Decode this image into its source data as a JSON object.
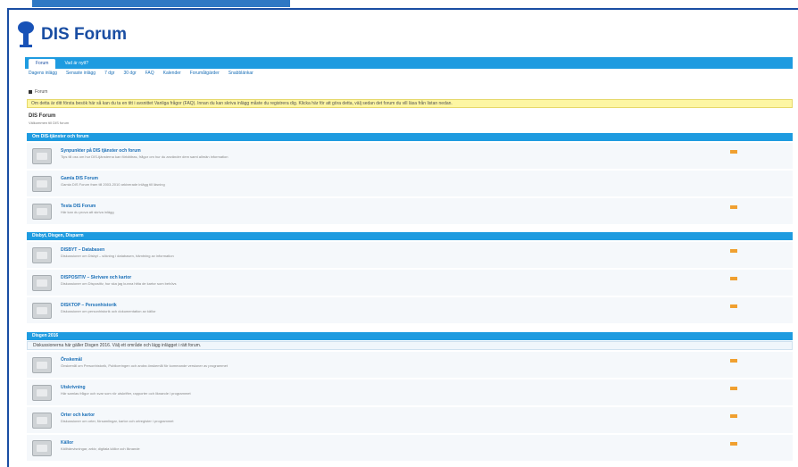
{
  "site": {
    "title": "DIS Forum"
  },
  "navbar": {
    "tabs": [
      "Forum",
      "Vad är nytt?"
    ]
  },
  "subnav": {
    "links": [
      "Dagens inlägg",
      "Senaste inlägg",
      "7 dgr",
      "30 dgr",
      "FAQ",
      "Kalender",
      "Forumåtgärder",
      "Snabblänkar"
    ]
  },
  "breadcrumb": {
    "home": "Forum"
  },
  "notice": {
    "text": "Om detta är ditt första besök här så kan du ta en titt i avsnittet Vanliga frågor (FAQ). Innan du kan skriva inlägg måste du registrera dig. Klicka här för att göra detta, välj sedan det forum du vill läsa från listan nedan."
  },
  "forum": {
    "title": "DIS Forum",
    "subtitle": "Välkommen till DIS forum"
  },
  "categories": [
    {
      "title": "Om DIS-tjänster och forum",
      "note": "",
      "rows": [
        {
          "title": "Synpunkter på DIS tjänster och forum",
          "desc": "Tips till oss om hur DIS-tjänsterna kan förbättras, frågor om hur du använder dem samt allmän information",
          "rss": true
        },
        {
          "title": "Gamla DIS Forum",
          "desc": "Gamla DIS Forum fram till 2003-2010 arkiverade inlägg till läsning",
          "rss": false
        },
        {
          "title": "Testa DIS Forum",
          "desc": "Här kan du prova att skriva inlägg",
          "rss": true
        }
      ]
    },
    {
      "title": "Disbyt, Disgen, Disparm",
      "note": "",
      "rows": [
        {
          "title": "DISBYT – Databasen",
          "desc": "Diskussioner om Disbyt – sökning i databasen, hämtning av information",
          "rss": true
        },
        {
          "title": "DISPOSITIV – Skrivare och kartor",
          "desc": "Diskussioner om Dispositiv, hur ska jag kunna hitta de kartor som behövs",
          "rss": true
        },
        {
          "title": "DISKTOP – Personhistorik",
          "desc": "Diskussioner om personhistorik och dokumentation av källor",
          "rss": true
        }
      ]
    },
    {
      "title": "Disgen 2016",
      "note": "Diskussionerna här gäller Disgen 2016. Välj ett område och lägg inlägget i rätt forum.",
      "rows": [
        {
          "title": "Önskemål",
          "desc": "Önskemål om Personhistorik, Publiceringen och andra önskemål för kommande versioner av programmet",
          "rss": true
        },
        {
          "title": "Utskrivning",
          "desc": "Här samlas frågor och svar som rör utskrifter, rapporter och liknande i programmet",
          "rss": true
        },
        {
          "title": "Orter och kartor",
          "desc": "Diskussioner om orter, församlingar, kartor och ortregister i programmet",
          "rss": true
        },
        {
          "title": "Källor",
          "desc": "Källhänvisningar, arkiv, digitala källor och liknande",
          "rss": true
        }
      ]
    }
  ]
}
